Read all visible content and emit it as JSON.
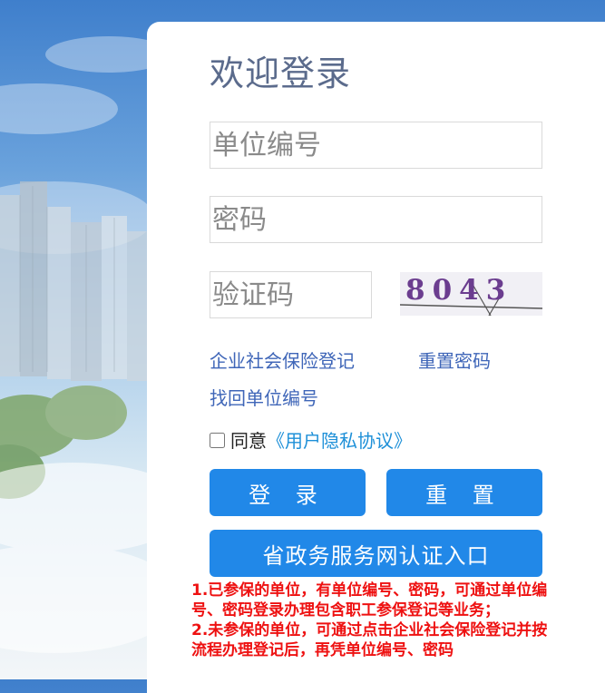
{
  "login": {
    "title": "欢迎登录",
    "company_id_placeholder": "单位编号",
    "password_placeholder": "密码",
    "captcha_placeholder": "验证码",
    "captcha_text": "8043"
  },
  "links": {
    "register": "企业社会保险登记",
    "reset_password": "重置密码",
    "find_company_id": "找回单位编号"
  },
  "agreement": {
    "prefix": "同意",
    "privacy_link": "《用户隐私协议》",
    "checked": false
  },
  "buttons": {
    "login": "登 录",
    "reset": "重 置",
    "province_auth": "省政务服务网认证入口"
  },
  "notice": {
    "item1": "1.已参保的单位，有单位编号、密码，可通过单位编号、密码登录办理包含职工参保登记等业务；",
    "item2": "2.未参保的单位，可通过点击企业社会保险登记并按流程办理登记后，再凭单位编号、密码"
  },
  "colors": {
    "primary_button": "#2188e8",
    "link": "#3f66b8",
    "notice": "#ee1111",
    "title": "#5b6b8c"
  }
}
